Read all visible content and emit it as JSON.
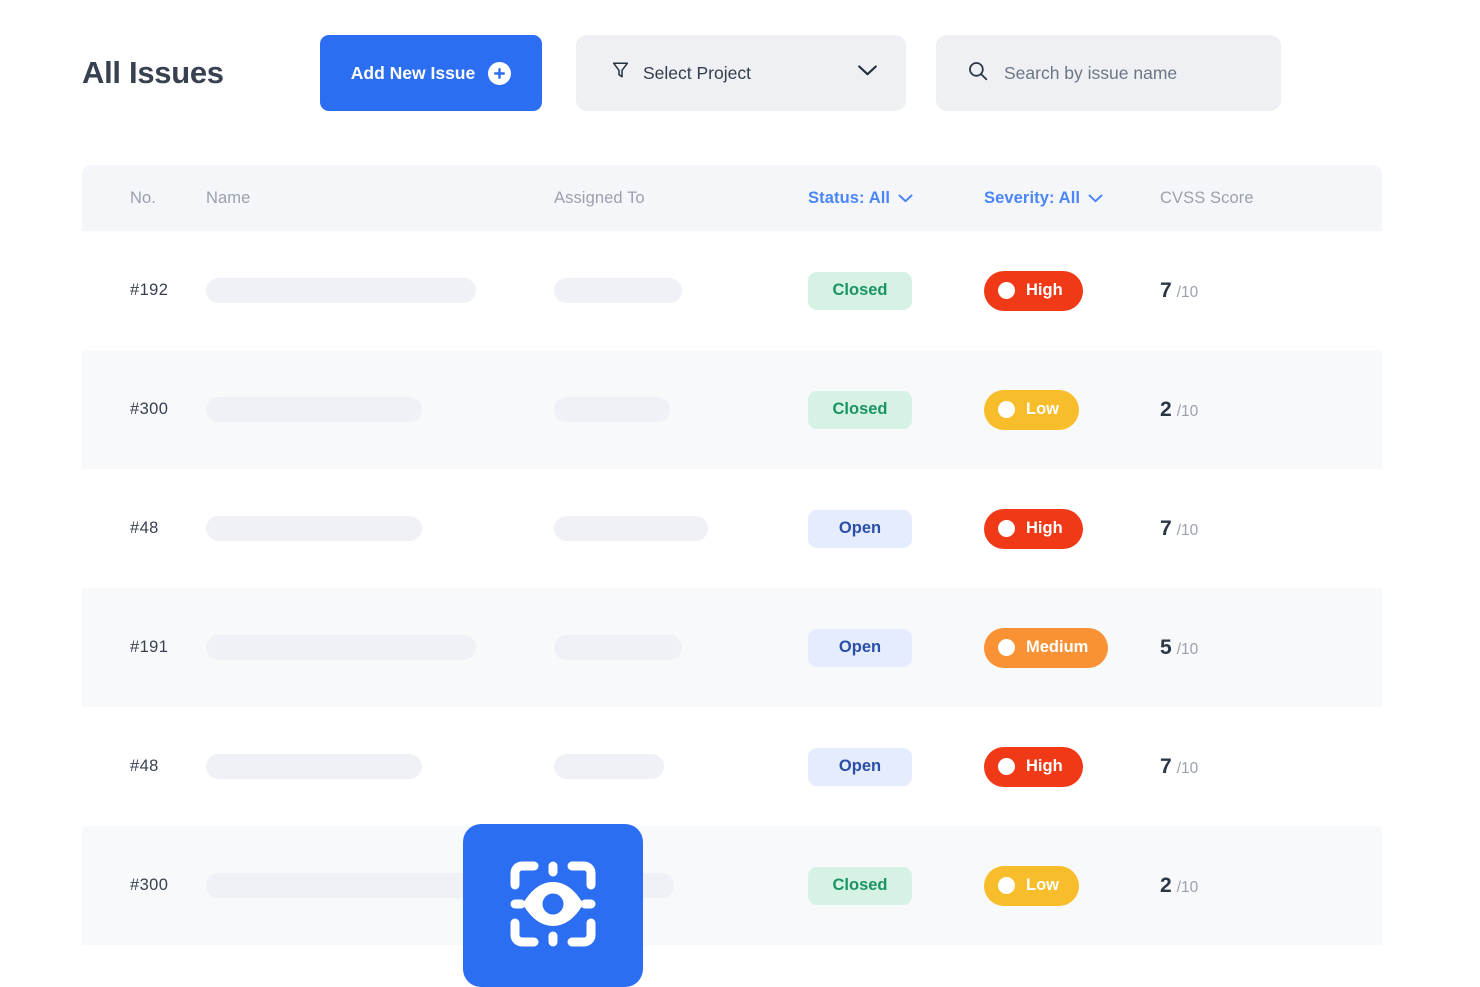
{
  "header": {
    "title": "All Issues",
    "add_button_label": "Add New Issue",
    "select_project_label": "Select Project",
    "search_placeholder": "Search by issue name",
    "accent_color": "#2c6ef2"
  },
  "table": {
    "columns": [
      {
        "key": "no",
        "label": "No."
      },
      {
        "key": "name",
        "label": "Name"
      },
      {
        "key": "assigned",
        "label": "Assigned To"
      },
      {
        "key": "status",
        "label": "Status: All",
        "filter": true
      },
      {
        "key": "severity",
        "label": "Severity: All",
        "filter": true
      },
      {
        "key": "cvss",
        "label": "CVSS Score"
      }
    ],
    "rows": [
      {
        "no": "#192",
        "name_width": 270,
        "assign_width": 128,
        "status": "Closed",
        "status_kind": "closed",
        "severity": "High",
        "severity_kind": "high",
        "score": "7",
        "out_of": "/10"
      },
      {
        "no": "#300",
        "name_width": 216,
        "assign_width": 116,
        "status": "Closed",
        "status_kind": "closed",
        "severity": "Low",
        "severity_kind": "low",
        "score": "2",
        "out_of": "/10"
      },
      {
        "no": "#48",
        "name_width": 216,
        "assign_width": 154,
        "status": "Open",
        "status_kind": "open",
        "severity": "High",
        "severity_kind": "high",
        "score": "7",
        "out_of": "/10"
      },
      {
        "no": "#191",
        "name_width": 270,
        "assign_width": 128,
        "status": "Open",
        "status_kind": "open",
        "severity": "Medium",
        "severity_kind": "medium",
        "score": "5",
        "out_of": "/10"
      },
      {
        "no": "#48",
        "name_width": 216,
        "assign_width": 110,
        "status": "Open",
        "status_kind": "open",
        "severity": "High",
        "severity_kind": "high",
        "score": "7",
        "out_of": "/10"
      },
      {
        "no": "#300",
        "name_width": 290,
        "assign_width": 120,
        "status": "Closed",
        "status_kind": "closed",
        "severity": "Low",
        "severity_kind": "low",
        "score": "2",
        "out_of": "/10"
      }
    ]
  },
  "colors": {
    "status_closed_bg": "#d5f2e5",
    "status_closed_fg": "#1a9462",
    "status_open_bg": "#e4ecfd",
    "status_open_fg": "#2a4fa8",
    "severity_high": "#f03a17",
    "severity_medium": "#f89235",
    "severity_low": "#f7bd2b",
    "header_row_bg": "#f5f6f9",
    "alt_row_bg": "#f8f9fb",
    "placeholder_bar": "#eff1f6"
  },
  "fab": {
    "icon": "scan-eye-icon",
    "color": "#2c6ef2"
  }
}
